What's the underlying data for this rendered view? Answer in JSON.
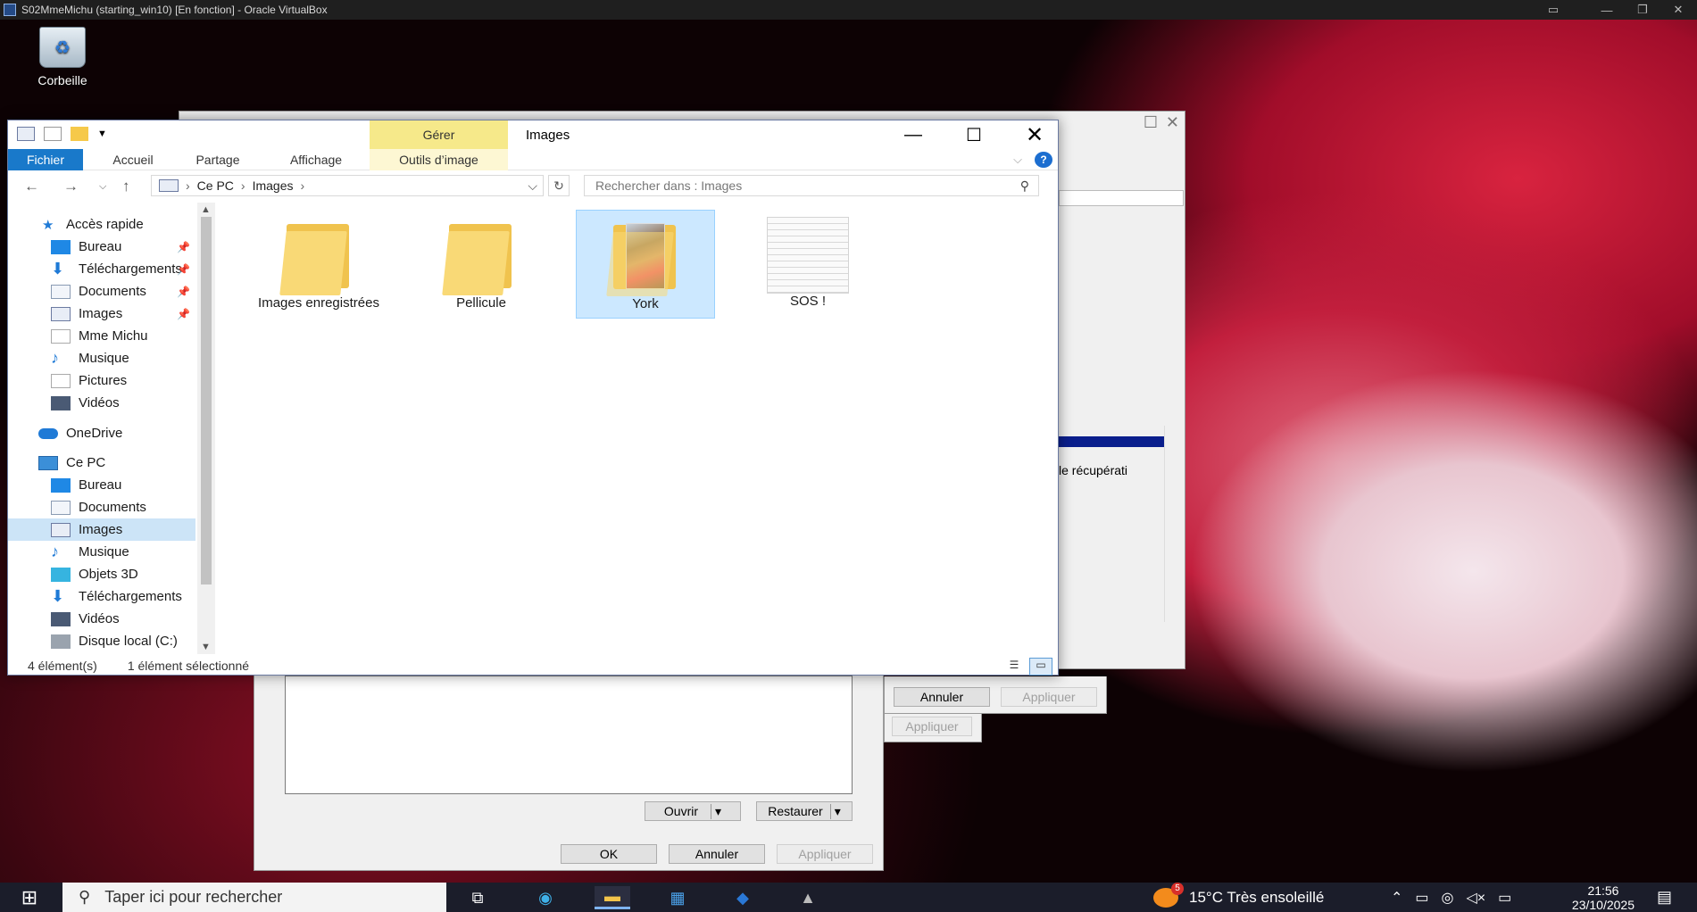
{
  "vbox": {
    "title": "S02MmeMichu (starting_win10) [En fonction] - Oracle VirtualBox",
    "controls": [
      "—",
      "❐",
      "✕"
    ]
  },
  "desktop": {
    "recycle_bin_label": "Corbeille"
  },
  "background_dialogs": {
    "dialog_a": {
      "open_label": "Ouvrir",
      "restore_label": "Restaurer",
      "ok_label": "OK",
      "cancel_label": "Annuler",
      "apply_label": "Appliquer"
    },
    "dialog_b": {
      "cancel_label": "Annuler",
      "apply_label": "Appliquer",
      "apply2_label": "Appliquer",
      "recovery_text": "le récupérati"
    }
  },
  "explorer": {
    "title": "Images",
    "manage_tab": "Gérer",
    "ribbon_tabs": [
      "Fichier",
      "Accueil",
      "Partage",
      "Affichage"
    ],
    "tools_tab": "Outils d’image",
    "help_label": "?",
    "address": {
      "root": "Ce PC",
      "current": "Images"
    },
    "search_placeholder": "Rechercher dans : Images",
    "sidebar": {
      "quick_access": "Accès rapide",
      "quick_items": [
        "Bureau",
        "Téléchargements",
        "Documents",
        "Images",
        "Mme Michu",
        "Musique",
        "Pictures",
        "Vidéos"
      ],
      "onedrive": "OneDrive",
      "this_pc": "Ce PC",
      "pc_items": [
        "Bureau",
        "Documents",
        "Images",
        "Musique",
        "Objets 3D",
        "Téléchargements",
        "Vidéos",
        "Disque local (C:)"
      ]
    },
    "items": [
      {
        "label": "Images enregistrées"
      },
      {
        "label": "Pellicule"
      },
      {
        "label": "York"
      },
      {
        "label": "SOS !"
      }
    ],
    "status": {
      "count": "4 élément(s)",
      "selection": "1 élément sélectionné"
    }
  },
  "taskbar": {
    "search_placeholder": "Taper ici pour rechercher",
    "weather": "15°C  Très ensoleillé",
    "weather_badge": "5",
    "time": "21:56",
    "date": "23/10/2025"
  }
}
